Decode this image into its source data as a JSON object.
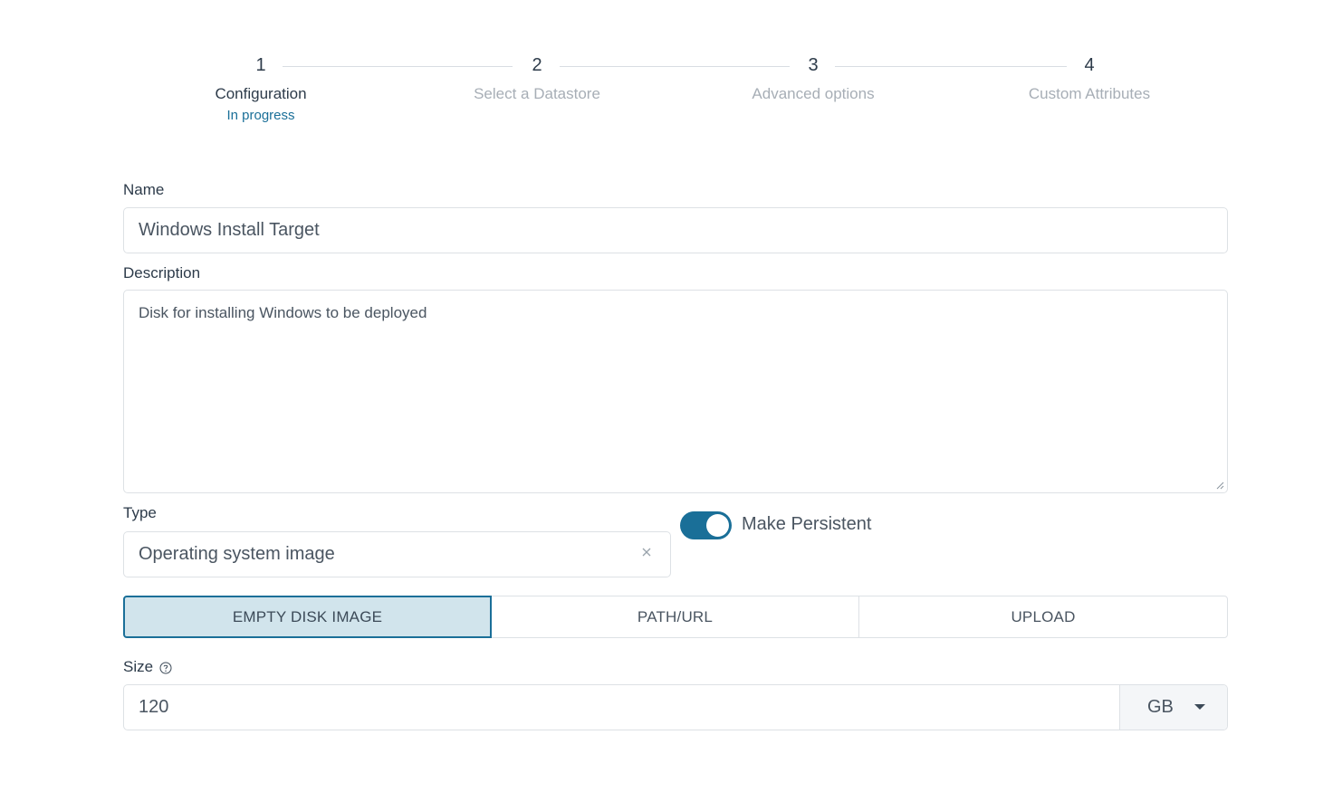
{
  "stepper": {
    "steps": [
      {
        "number": "1",
        "title": "Configuration",
        "status": "In progress"
      },
      {
        "number": "2",
        "title": "Select a Datastore"
      },
      {
        "number": "3",
        "title": "Advanced options"
      },
      {
        "number": "4",
        "title": "Custom Attributes"
      }
    ],
    "active_step": 1
  },
  "form": {
    "name": {
      "label": "Name",
      "value": "Windows Install Target"
    },
    "description": {
      "label": "Description",
      "value": "Disk for installing Windows to be deployed"
    },
    "type": {
      "label": "Type",
      "value": "Operating system image"
    },
    "persistent": {
      "label": "Make Persistent",
      "checked": true
    },
    "source_tabs": {
      "options": [
        "EMPTY DISK IMAGE",
        "PATH/URL",
        "UPLOAD"
      ],
      "selected": "EMPTY DISK IMAGE"
    },
    "size": {
      "label": "Size",
      "value": "120",
      "unit": "GB"
    }
  },
  "colors": {
    "accent": "#1a6f98",
    "active_segment_bg": "#d1e4ec",
    "inactive_step_text": "#a7aeb6"
  }
}
